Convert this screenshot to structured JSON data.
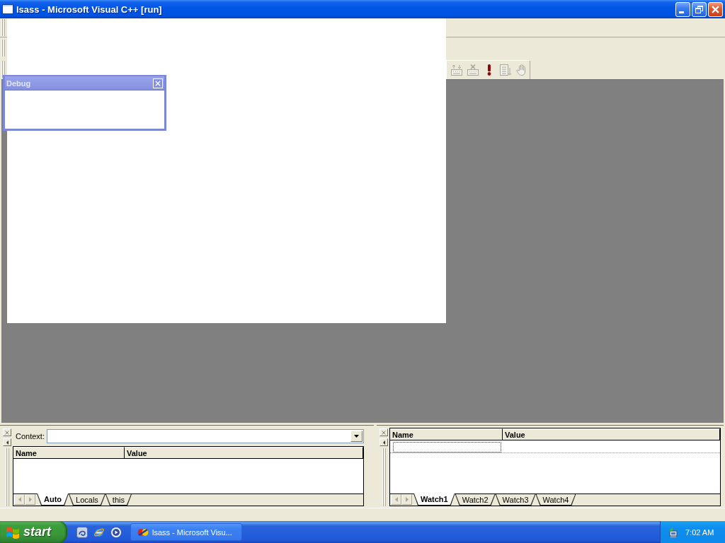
{
  "window": {
    "title": "lsass - Microsoft Visual C++ [run]"
  },
  "toolbar": {
    "buttons": [
      {
        "kind": "keyboard",
        "disabled": true
      },
      {
        "kind": "cross",
        "disabled": true
      },
      {
        "kind": "exclaim",
        "disabled": false
      },
      {
        "kind": "page",
        "disabled": true
      },
      {
        "kind": "hand",
        "disabled": true
      }
    ]
  },
  "debug_toolbar": {
    "title": "Debug"
  },
  "variables_pane": {
    "context_label": "Context:",
    "columns": [
      "Name",
      "Value"
    ],
    "tab_scroll": {
      "disabled": true
    },
    "tabs": [
      {
        "label": "Auto",
        "selected": true
      },
      {
        "label": "Locals",
        "selected": false
      },
      {
        "label": "this",
        "selected": false
      }
    ]
  },
  "watch_pane": {
    "columns": [
      "Name",
      "Value"
    ],
    "tab_scroll": {
      "disabled": true
    },
    "tabs": [
      {
        "label": "Watch1",
        "selected": true
      },
      {
        "label": "Watch2",
        "selected": false
      },
      {
        "label": "Watch3",
        "selected": false
      },
      {
        "label": "Watch4",
        "selected": false
      }
    ]
  },
  "taskbar": {
    "start_label": "start",
    "tasks": [
      {
        "label": "lsass - Microsoft Visu...",
        "selected": false
      }
    ],
    "clock": "7:02 AM"
  }
}
